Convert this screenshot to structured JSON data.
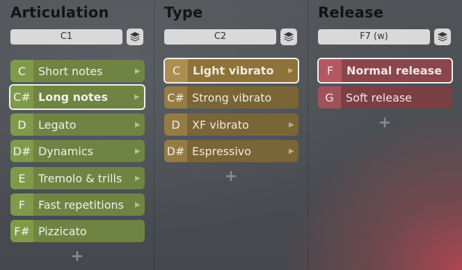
{
  "columns": [
    {
      "title": "Articulation",
      "key": "C1",
      "items": [
        {
          "note": "C",
          "label": "Short notes",
          "arrow": true,
          "selected": false
        },
        {
          "note": "C#",
          "label": "Long notes",
          "arrow": true,
          "selected": true
        },
        {
          "note": "D",
          "label": "Legato",
          "arrow": true,
          "selected": false
        },
        {
          "note": "D#",
          "label": "Dynamics",
          "arrow": true,
          "selected": false
        },
        {
          "note": "E",
          "label": "Tremolo & trills",
          "arrow": true,
          "selected": false
        },
        {
          "note": "F",
          "label": "Fast repetitions",
          "arrow": true,
          "selected": false
        },
        {
          "note": "F#",
          "label": "Pizzicato",
          "arrow": false,
          "selected": false
        }
      ],
      "add": "+"
    },
    {
      "title": "Type",
      "key": "C2",
      "items": [
        {
          "note": "C",
          "label": "Light vibrato",
          "arrow": true,
          "selected": true
        },
        {
          "note": "C#",
          "label": "Strong vibrato",
          "arrow": false,
          "selected": false
        },
        {
          "note": "D",
          "label": "XF vibrato",
          "arrow": true,
          "selected": false
        },
        {
          "note": "D#",
          "label": "Espressivo",
          "arrow": true,
          "selected": false
        }
      ],
      "add": "+"
    },
    {
      "title": "Release",
      "key": "F7 (w)",
      "items": [
        {
          "note": "F",
          "label": "Normal release",
          "arrow": false,
          "selected": true
        },
        {
          "note": "G",
          "label": "Soft release",
          "arrow": false,
          "selected": false
        }
      ],
      "add": "+"
    }
  ],
  "icons": {
    "layers": "layers-icon",
    "arrow": "chevron-right-icon"
  },
  "colors": {
    "articulation": "#6f8442",
    "type": "#7a6537",
    "release": "#7a3f45",
    "selected_border": "#f2f2f2"
  }
}
